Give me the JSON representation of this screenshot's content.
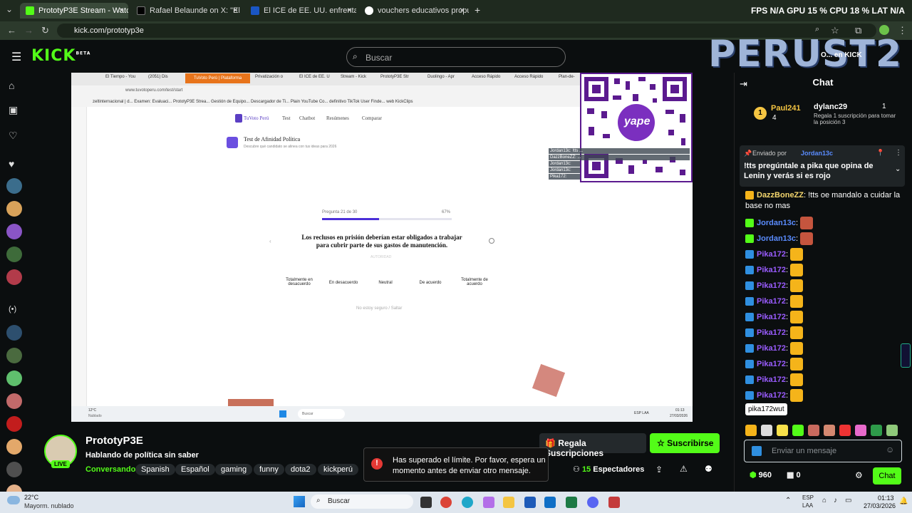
{
  "browser": {
    "tabs": [
      {
        "label": "PrototyP3E Stream - Watch Live",
        "color": "#53fc18",
        "active": true
      },
      {
        "label": "Rafael Belaunde on X: \"El Perú",
        "color": "#000000",
        "active": false
      },
      {
        "label": "El ICE de EE. UU. enfrentará jui",
        "color": "#1a56c4",
        "active": false
      },
      {
        "label": "vouchers educativos propuesta",
        "color": "#ffffff",
        "active": false
      }
    ],
    "new_tab": "+",
    "perf": "FPS  N/A     GPU  15 %     CPU  18 %     LAT  N/A",
    "url": "kick.com/prototyp3e"
  },
  "kick": {
    "logo": "KICK",
    "logo_badge": "BETA",
    "search_placeholder": "Buscar"
  },
  "overlay": {
    "brand": "PERUST2",
    "watermark": "O... en KICK"
  },
  "stream_screen": {
    "tabs": [
      "El Tiempo - You",
      "(2051) Dis",
      "TuVoto Perú | Plataforma",
      "Privatización o",
      "El ICE de EE. U",
      "Stream - Kick",
      "PrototyP3E Str",
      "Duolingo - Apr",
      "Acceso Rápido",
      "Acceso Rápido",
      "Plan-de-"
    ],
    "url": "www.tuvotoperu.com/test/start",
    "bookmarks": "zeltinternacional | d...   Examen: Evaluaci...   PrototyP3E Strea...   Gestión de Equipo...   Descargador de Ti...   Plain YouTube Co...   definitivo   TikTok User Finde...   web   KickClips",
    "site_logo": "TuVoto Perú",
    "site_nav": [
      "Test",
      "Chatbot",
      "Resúmenes",
      "Comparar"
    ],
    "test_title": "Test de Afinidad Política",
    "test_sub": "Descubre qué candidato se alinea con tus ideas para 2026",
    "progress_label": "Pregunta 21 de 30",
    "progress_pct": "67%",
    "progress_value": 0.67,
    "question": "Los reclusos en prisión deberían estar obligados a trabajar para cubrir parte de sus gastos de manutención.",
    "category": "AUTORIDAD",
    "options": [
      "Totalmente en desacuerdo",
      "En desacuerdo",
      "Neutral",
      "De acuerdo",
      "Totalmente de acuerdo"
    ],
    "skip": "No estoy seguro / Saltar",
    "weather": "12°C",
    "weather_sub": "Nublado",
    "search": "Buscar",
    "lang": "ESP LAA",
    "clock": "01:13",
    "date": "27/03/2026",
    "qr_label": "yape",
    "mini_chat": [
      "Jordan13c: !tts ...",
      "DazzBoneZZ: ...",
      "Jordan13c:",
      "Jordan13c:",
      "Pika172:"
    ]
  },
  "channel": {
    "name": "PrototyP3E",
    "title": "Hablando de política sin saber",
    "category": "Conversando",
    "tags": [
      "Spanish",
      "Español",
      "gaming",
      "funny",
      "dota2",
      "kickperú"
    ],
    "live_badge": "LIVE",
    "gift_button": "Regala Suscripciones",
    "subscribe_button": "Suscribirse",
    "viewers": "15",
    "viewers_label": "Espectadores"
  },
  "toast": {
    "text": "Has superado el límite. Por favor, espera un momento antes de enviar otro mensaje."
  },
  "chat": {
    "title": "Chat",
    "leaders": [
      {
        "name": "Paul241",
        "count": "4",
        "rank": "1"
      },
      {
        "name": "dylanc29",
        "count": "1"
      }
    ],
    "gift_prompt": "Regala 1 suscripción para tomar la posición 3",
    "pinned_by_label": "Enviado por",
    "pinned_user": "Jordan13c",
    "pinned_text": "!tts pregúntale a pika que opina de Lenin y verás si es rojo",
    "messages": [
      {
        "user": "DazzBoneZZ",
        "text": "!tts oe mandalo a cuidar la",
        "color": "#f5d76e"
      },
      {
        "user": "",
        "text": "base no mas",
        "color": "#ffffff"
      },
      {
        "user": "Jordan13c",
        "text": "",
        "color": "#5a8cff"
      },
      {
        "user": "Jordan13c",
        "text": "",
        "color": "#5a8cff"
      },
      {
        "user": "Pika172",
        "text": "",
        "color": "#9a5cff"
      },
      {
        "user": "Pika172",
        "text": "",
        "color": "#9a5cff"
      },
      {
        "user": "Pika172",
        "text": "",
        "color": "#9a5cff"
      },
      {
        "user": "Pika172",
        "text": "",
        "color": "#9a5cff"
      },
      {
        "user": "Pika172",
        "text": "",
        "color": "#9a5cff"
      },
      {
        "user": "Pika172",
        "text": "",
        "color": "#9a5cff"
      },
      {
        "user": "Pika172",
        "text": "",
        "color": "#9a5cff"
      },
      {
        "user": "Pika172",
        "text": "",
        "color": "#9a5cff"
      },
      {
        "user": "Pika172",
        "text": "",
        "color": "#9a5cff"
      },
      {
        "user": "Pika172",
        "text": "",
        "color": "#9a5cff"
      }
    ],
    "tooltip": "pika172wut",
    "input_placeholder": "Enviar un mensaje",
    "points": "960",
    "gifts": "0",
    "send_button": "Chat"
  },
  "windows": {
    "weather_temp": "22°C",
    "weather_desc": "Mayorm. nublado",
    "search": "Buscar",
    "lang": "ESP",
    "lang2": "LAA",
    "time": "01:13",
    "date": "27/03/2026"
  }
}
